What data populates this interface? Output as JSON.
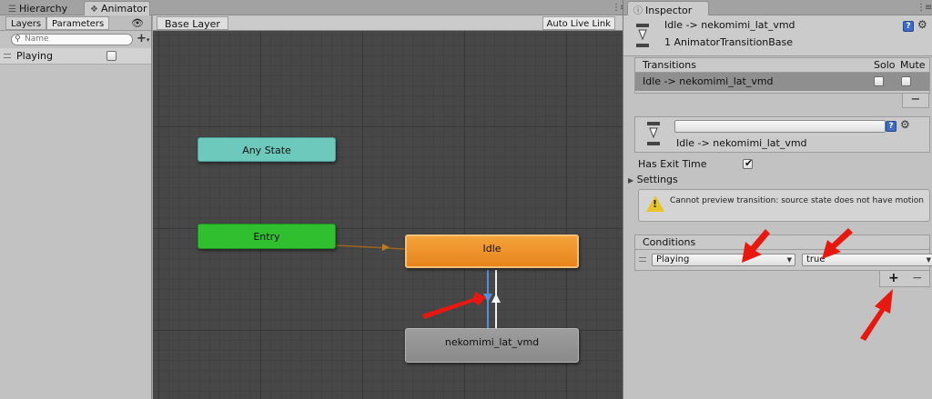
{
  "tabs": {
    "hierarchy": "Hierarchy",
    "animator": "Animator",
    "inspector": "Inspector"
  },
  "left_panel": {
    "subtabs": [
      "Layers",
      "Parameters"
    ],
    "search_placeholder": "Name",
    "parameters": [
      {
        "name": "Playing",
        "value": false
      }
    ]
  },
  "graph": {
    "breadcrumb": "Base Layer",
    "auto_live_link": "Auto Live Link",
    "states": {
      "any_state": "Any State",
      "entry": "Entry",
      "idle": "Idle",
      "nekomimi": "nekomimi_lat_vmd"
    }
  },
  "inspector": {
    "title": "Idle -> nekomimi_lat_vmd",
    "subtitle": "1 AnimatorTransitionBase",
    "transitions": {
      "header": "Transitions",
      "solo_label": "Solo",
      "mute_label": "Mute",
      "rows": [
        {
          "name": "Idle -> nekomimi_lat_vmd",
          "solo": false,
          "mute": false
        }
      ],
      "remove_label": "−"
    },
    "transition_detail": {
      "name_value": "",
      "label": "Idle -> nekomimi_lat_vmd"
    },
    "has_exit_time": {
      "label": "Has Exit Time",
      "checked": true
    },
    "settings_label": "Settings",
    "warning": "Cannot preview transition: source state does not have motion",
    "conditions": {
      "header": "Conditions",
      "rows": [
        {
          "parameter": "Playing",
          "value": "true"
        }
      ],
      "add_label": "+",
      "remove_label": "−"
    }
  },
  "colors": {
    "any_state": "#6ec9bd",
    "entry": "#2fbf2f",
    "idle": "#ee9228",
    "default_state": "#949494",
    "annotation_arrow": "#e8180f",
    "graph_bg": "#474747"
  }
}
